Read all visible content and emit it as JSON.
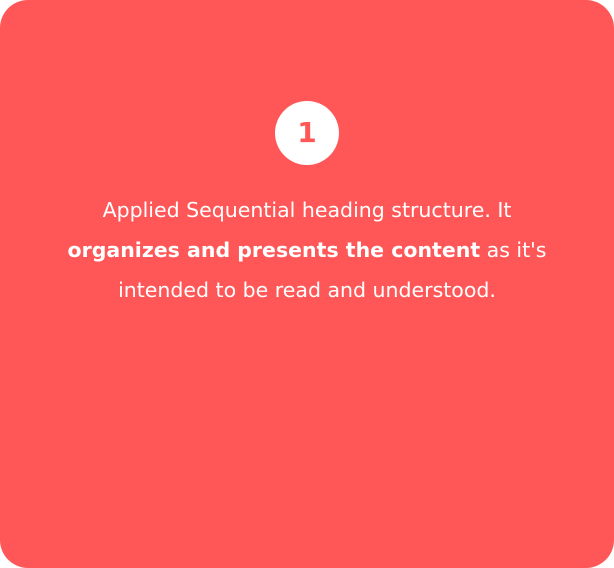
{
  "card": {
    "background_color": "#ff5757",
    "step_number": "1",
    "description": {
      "line1": "Applied Sequential heading structure. It",
      "emphasis": "organizes and presents the content",
      "after_emphasis": " as it's",
      "line3": "intended to be read and understood."
    }
  }
}
